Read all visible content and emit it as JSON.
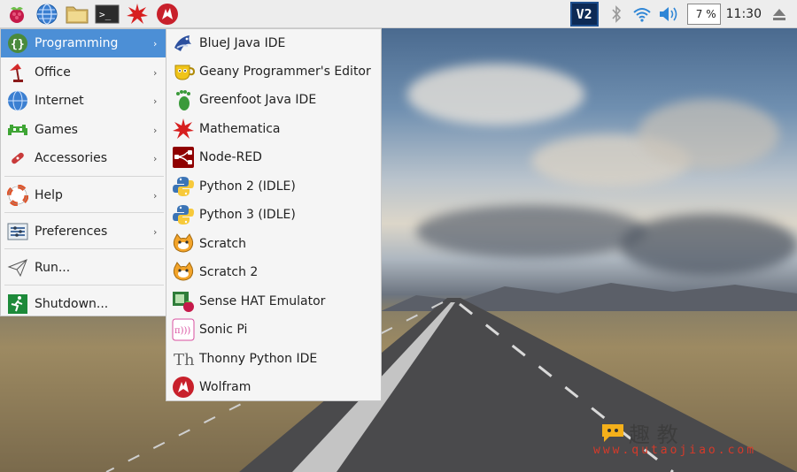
{
  "taskbar": {
    "launchers": [
      "raspberry-menu",
      "web-browser",
      "file-manager",
      "terminal",
      "mathematica",
      "wolfram"
    ],
    "cpu_usage": "7 %",
    "clock": "11:30",
    "vnc_label": "V2"
  },
  "menu": {
    "items": [
      {
        "label": "Programming",
        "icon": "braces-icon",
        "has_submenu": true,
        "active": true
      },
      {
        "label": "Office",
        "icon": "lamp-icon",
        "has_submenu": true
      },
      {
        "label": "Internet",
        "icon": "globe-icon",
        "has_submenu": true
      },
      {
        "label": "Games",
        "icon": "alien-icon",
        "has_submenu": true
      },
      {
        "label": "Accessories",
        "icon": "knife-icon",
        "has_submenu": true
      },
      {
        "label": "Help",
        "icon": "lifebuoy-icon",
        "has_submenu": true
      },
      {
        "label": "Preferences",
        "icon": "settings-icon",
        "has_submenu": true
      },
      {
        "label": "Run...",
        "icon": "paper-plane-icon",
        "has_submenu": false
      },
      {
        "label": "Shutdown...",
        "icon": "exit-icon",
        "has_submenu": false
      }
    ]
  },
  "submenu": {
    "items": [
      {
        "label": "BlueJ Java IDE",
        "icon": "bluej-icon"
      },
      {
        "label": "Geany Programmer's Editor",
        "icon": "geany-icon"
      },
      {
        "label": "Greenfoot Java IDE",
        "icon": "greenfoot-icon"
      },
      {
        "label": "Mathematica",
        "icon": "mathematica-icon"
      },
      {
        "label": "Node-RED",
        "icon": "node-red-icon"
      },
      {
        "label": "Python 2 (IDLE)",
        "icon": "python-icon"
      },
      {
        "label": "Python 3 (IDLE)",
        "icon": "python-icon"
      },
      {
        "label": "Scratch",
        "icon": "scratch-icon"
      },
      {
        "label": "Scratch 2",
        "icon": "scratch-icon"
      },
      {
        "label": "Sense HAT Emulator",
        "icon": "sense-hat-icon"
      },
      {
        "label": "Sonic Pi",
        "icon": "sonic-pi-icon"
      },
      {
        "label": "Thonny Python IDE",
        "icon": "thonny-icon"
      },
      {
        "label": "Wolfram",
        "icon": "wolfram-icon"
      }
    ]
  },
  "watermark": {
    "title": "趣 教",
    "url": "www.qutaojiao.com"
  },
  "colors": {
    "menu_highlight": "#4c8fd6",
    "taskbar_bg": "#ededed",
    "menu_bg": "#f5f5f5"
  }
}
